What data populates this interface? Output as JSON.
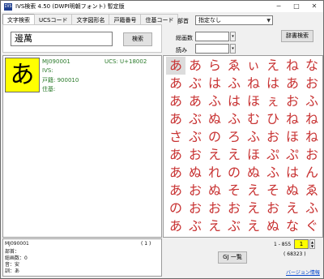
{
  "window": {
    "app_icon_label": "IVS",
    "title": "IVS検索 4.50 (DWPI明朝フォント) 暫定版",
    "controls": [
      "─",
      "□",
      "✕"
    ]
  },
  "tabs": [
    {
      "label": "文字検索",
      "active": true
    },
    {
      "label": "UCSコード",
      "active": false
    },
    {
      "label": "文字図形名",
      "active": false
    },
    {
      "label": "戸籍番号",
      "active": false
    },
    {
      "label": "住基コード",
      "active": false
    }
  ],
  "search": {
    "value": "邊萬",
    "button_label": "検索"
  },
  "filters": {
    "radical_label": "部首",
    "radical_value": "指定なし",
    "strokes_label": "総画数",
    "strokes_value": "",
    "reading_label": "読み",
    "reading_value": "",
    "dict_button_label": "辞書検索"
  },
  "detail": {
    "glyph": "あ",
    "mj_number": "MJ090001",
    "ucs": "UCS: U+18002",
    "ivs_label": "IVS:",
    "koseki": "戸籍: 900010",
    "juki": "住基:"
  },
  "grid_chars": [
    "あ",
    "あ",
    "ら",
    "ゑ",
    "ぃ",
    "え",
    "ね",
    "な",
    "あ",
    "ぶ",
    "は",
    "ふ",
    "ね",
    "は",
    "あ",
    "お",
    "あ",
    "あ",
    "ふ",
    "は",
    "ほ",
    "ぇ",
    "お",
    "ふ",
    "あ",
    "ぶ",
    "ぬ",
    "ふ",
    "む",
    "ひ",
    "ね",
    "ね",
    "さ",
    "ぶ",
    "の",
    "ろ",
    "ふ",
    "お",
    "ほ",
    "ね",
    "あ",
    "お",
    "え",
    "え",
    "ほ",
    "ぷ",
    "ぷ",
    "お",
    "あ",
    "ぬ",
    "れ",
    "の",
    "ぬ",
    "ふ",
    "は",
    "ん",
    "あ",
    "お",
    "ぬ",
    "そ",
    "え",
    "そ",
    "ぬ",
    "ゑ",
    "の",
    "お",
    "お",
    "お",
    "え",
    "お",
    "え",
    "ふ",
    "あ",
    "ぶ",
    "え",
    "ぶ",
    "え",
    "ぬ",
    "な",
    "ぐ"
  ],
  "status": {
    "mj": "MJ090001",
    "counter": "( 1 )",
    "radical": "部首：",
    "strokes": "総画数：0",
    "on_reading": "音：安",
    "kun_reading": "訓：あ"
  },
  "pager": {
    "range": "1 - 855",
    "page": "1",
    "total": "( 68323 )",
    "gj_button_label": "GJ 一覧"
  },
  "version_link": "バージョン情報"
}
